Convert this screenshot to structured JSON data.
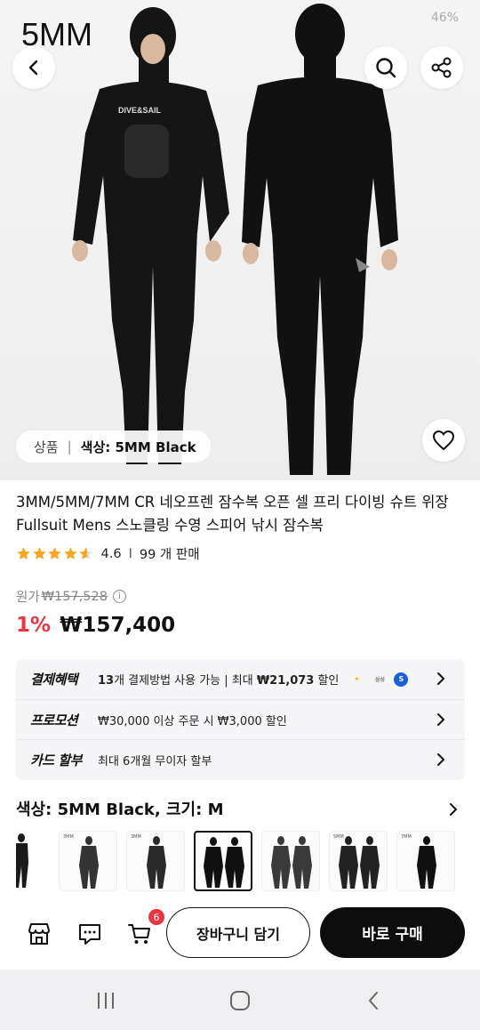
{
  "hero": {
    "overlay_label": "5MM",
    "status_text": "46%",
    "brand_print": "DIVE&SAIL",
    "breadcrumb": {
      "category": "상품",
      "selected_option": "색상: 5MM Black"
    }
  },
  "product": {
    "title": "3MM/5MM/7MM CR 네오프렌 잠수복 오픈 셀 프리 다이빙 슈트 위장 Fullsuit Mens 스노클링 수영 스피어 낚시 잠수복",
    "rating": 4.6,
    "rating_text": "4.6",
    "sold_text": "99 개 판매",
    "original_price_label": "원가",
    "original_price": "₩157,528",
    "discount": "1%",
    "price": "₩157,400"
  },
  "benefits": [
    {
      "title": "결제혜택",
      "prefix_bold": "13",
      "text": "개 결제방법 사용 가능 | 최대 ",
      "amount": "₩21,073",
      "suffix": " 할인"
    },
    {
      "title": "프로모션",
      "text": "₩30,000 이상 주문 시 ₩3,000 할인"
    },
    {
      "title": "카드 할부",
      "text": "최대 6개월 무이자 할부"
    }
  ],
  "options": {
    "title": "색상: 5MM Black, 크기: M",
    "thumbnails": [
      {
        "label": "",
        "selected": false
      },
      {
        "label": "3MM",
        "selected": false
      },
      {
        "label": "3MM",
        "selected": false
      },
      {
        "label": "",
        "selected": true
      },
      {
        "label": "",
        "selected": false
      },
      {
        "label": "5MM",
        "selected": false
      },
      {
        "label": "7MM",
        "selected": false
      }
    ]
  },
  "bottom_bar": {
    "cart_count": "6",
    "add_to_cart_label": "장바구니 담기",
    "buy_now_label": "바로 구매"
  },
  "colors": {
    "discount": "#e8353f",
    "star": "#f5a623",
    "buy_button": "#0d0d0d"
  }
}
